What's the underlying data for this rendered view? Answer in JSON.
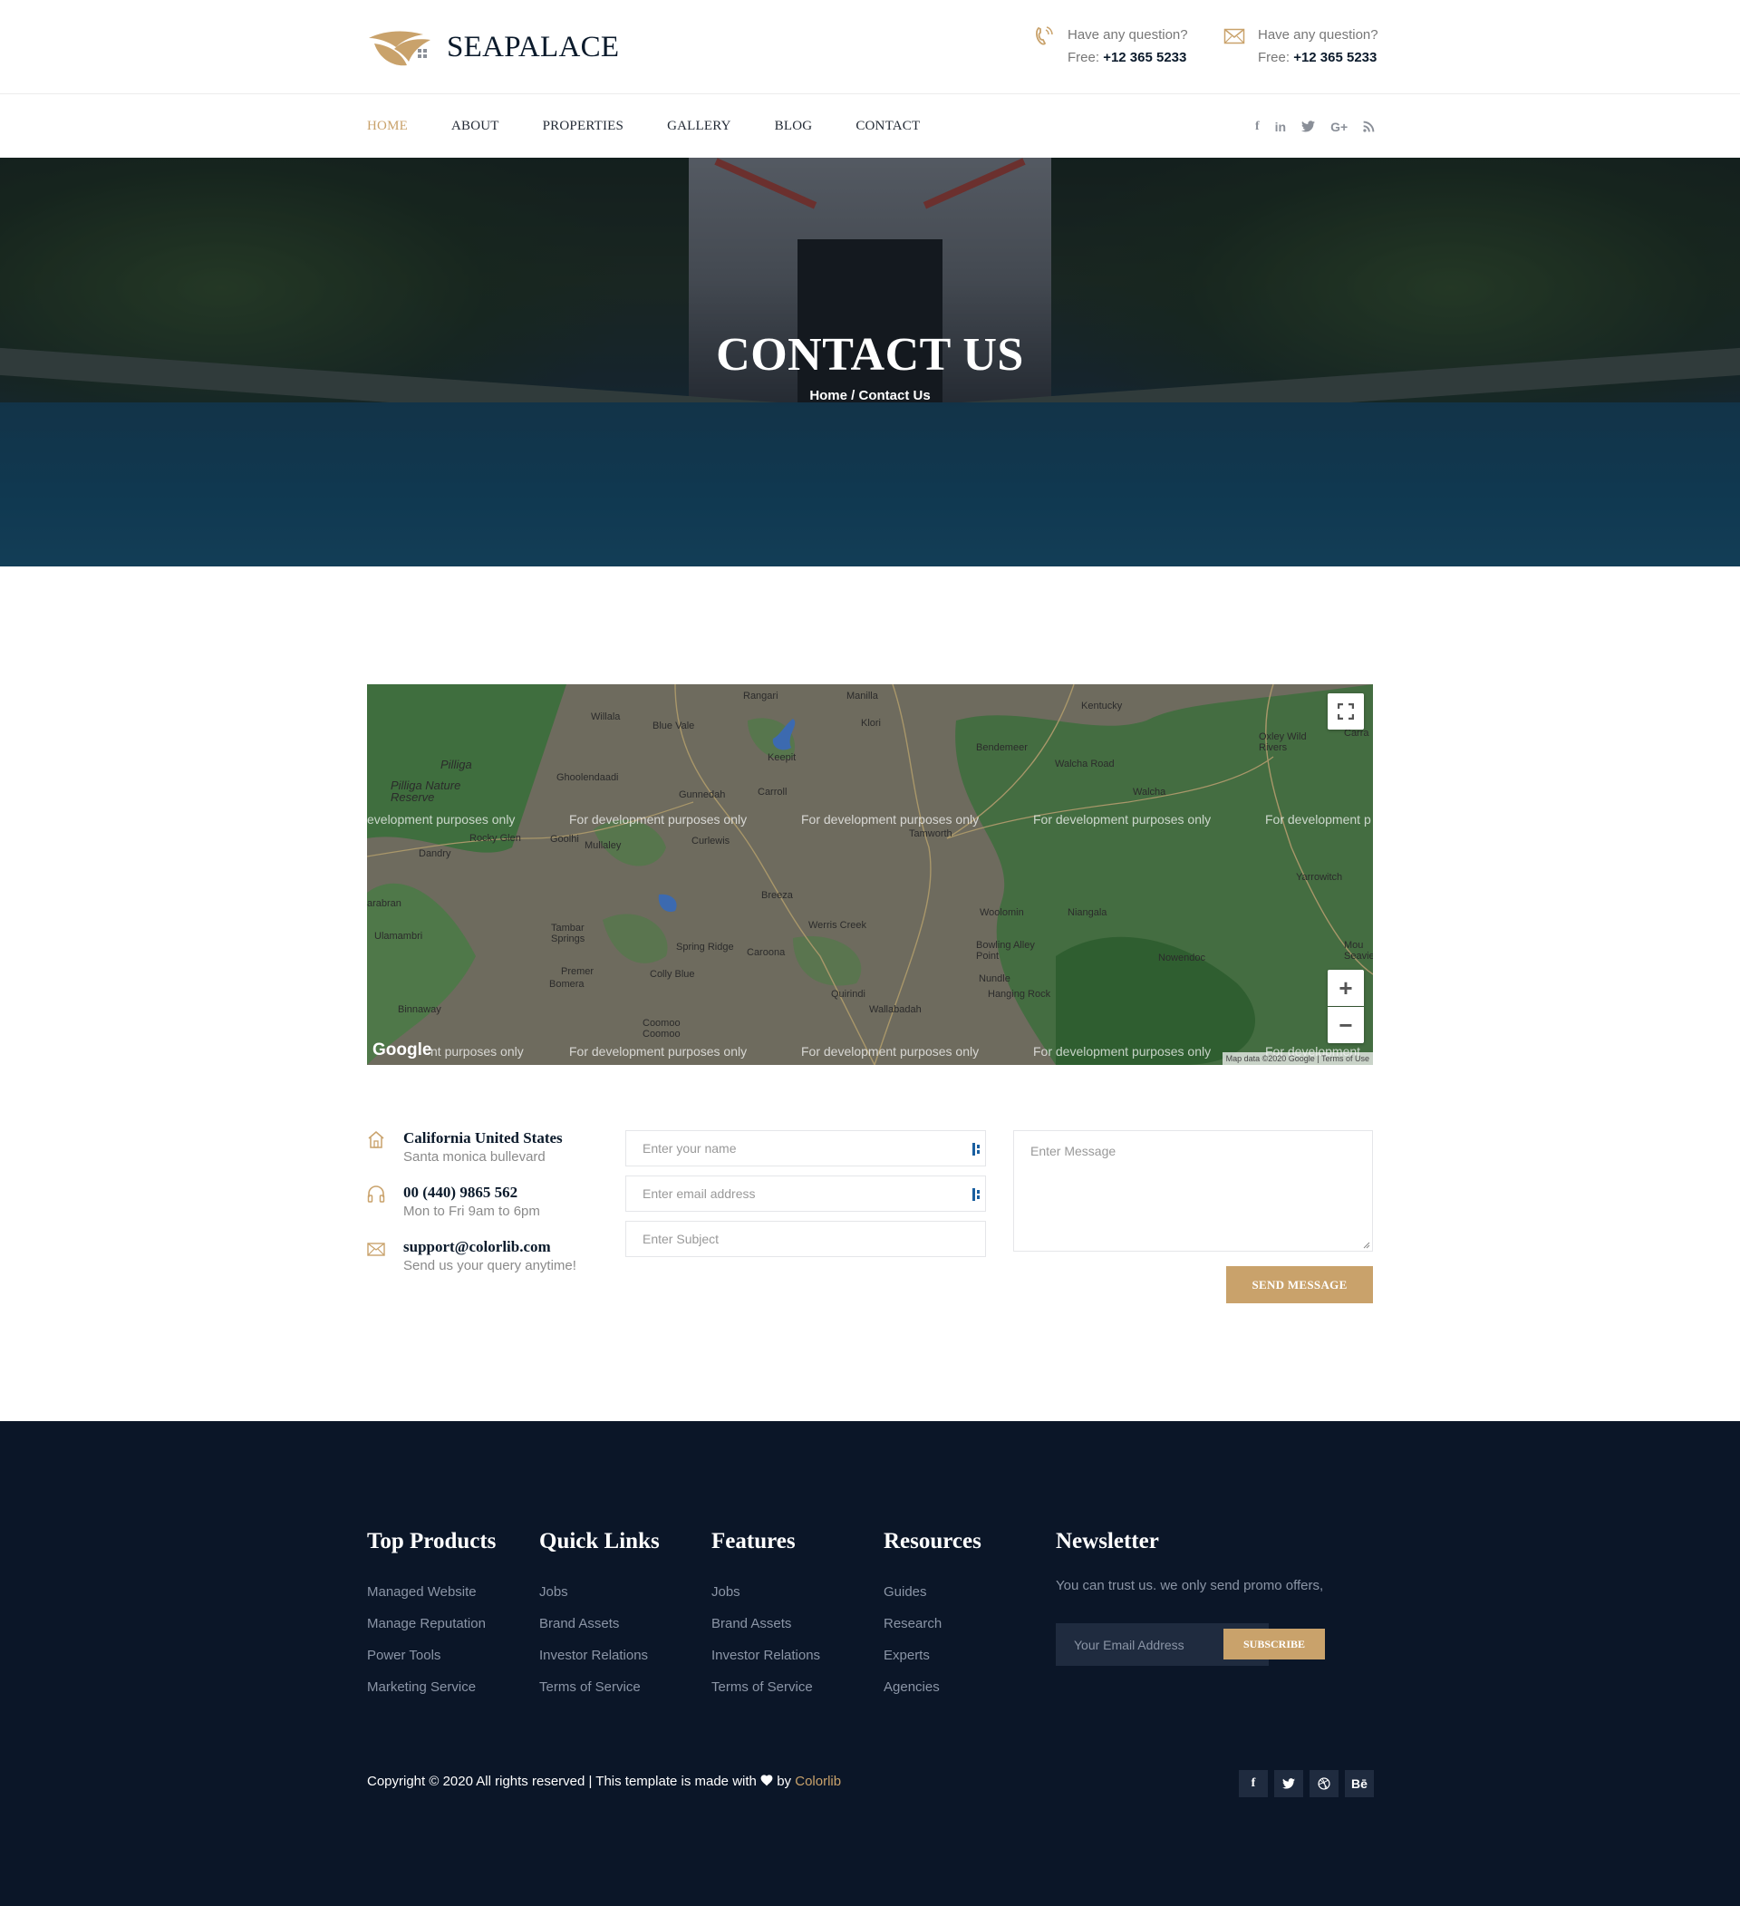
{
  "brand": {
    "name": "SEAPALACE"
  },
  "header": {
    "contacts": [
      {
        "icon": "phone-icon",
        "question": "Have any question?",
        "free_label": "Free:",
        "number": "+12 365 5233"
      },
      {
        "icon": "envelope-icon",
        "question": "Have any question?",
        "free_label": "Free:",
        "number": "+12 365 5233"
      }
    ]
  },
  "nav": {
    "items": [
      "HOME",
      "ABOUT",
      "PROPERTIES",
      "GALLERY",
      "BLOG",
      "CONTACT"
    ],
    "active": "HOME",
    "social": [
      "f",
      "in",
      "twitter-icon",
      "G+",
      "rss-icon"
    ]
  },
  "hero": {
    "title": "CONTACT US",
    "breadcrumb": "Home / Contact Us"
  },
  "map": {
    "watermark": "For development purposes only",
    "watermark_partial_left": "evelopment purposes only",
    "watermark_partial_right": "For development p",
    "watermark_bottom_left": "nt purposes only",
    "watermark_bottom_right": "For development",
    "places": [
      "Willala",
      "Blue Vale",
      "Rangari",
      "Manilla",
      "Kentucky",
      "Oxley Wild Rivers",
      "Pilliga",
      "Pilliga Nature Reserve",
      "Ghoolendaadi",
      "Keepit",
      "Klori",
      "Bendemeer",
      "Walcha Road",
      "Walcha",
      "Gunnedah",
      "Carroll",
      "Tamworth",
      "Rocky Glen",
      "Goolhi",
      "Mullaley",
      "Curlewis",
      "Dandry",
      "Yarrowitch",
      "arabran",
      "Breeza",
      "Woolomin",
      "Niangala",
      "Ulamambri",
      "Tambar Springs",
      "Werris Creek",
      "Spring Ridge",
      "Caroona",
      "Bowling Alley Point",
      "Nowendoc",
      "Premer",
      "Bomera",
      "Colly Blue",
      "Nundle",
      "Quirindi",
      "Hanging Rock",
      "Wallabadah",
      "Binnaway",
      "Coomoo Coomoo",
      "Mou Seavie",
      "Carra"
    ],
    "logo": "Google",
    "attribution": "Map data ©2020 Google | Terms of Use",
    "zoom_in": "+",
    "zoom_out": "−"
  },
  "contact_info": [
    {
      "icon": "home-icon",
      "title": "California United States",
      "sub": "Santa monica bullevard"
    },
    {
      "icon": "headphones-icon",
      "title": "00 (440) 9865 562",
      "sub": "Mon to Fri 9am to 6pm"
    },
    {
      "icon": "envelope-icon",
      "title": "support@colorlib.com",
      "sub": "Send us your query anytime!"
    }
  ],
  "form": {
    "name_placeholder": "Enter your name",
    "email_placeholder": "Enter email address",
    "subject_placeholder": "Enter Subject",
    "message_placeholder": "Enter Message",
    "submit_label": "SEND MESSAGE"
  },
  "footer": {
    "columns": [
      {
        "title": "Top Products",
        "links": [
          "Managed Website",
          "Manage Reputation",
          "Power Tools",
          "Marketing Service"
        ]
      },
      {
        "title": "Quick Links",
        "links": [
          "Jobs",
          "Brand Assets",
          "Investor Relations",
          "Terms of Service"
        ]
      },
      {
        "title": "Features",
        "links": [
          "Jobs",
          "Brand Assets",
          "Investor Relations",
          "Terms of Service"
        ]
      },
      {
        "title": "Resources",
        "links": [
          "Guides",
          "Research",
          "Experts",
          "Agencies"
        ]
      }
    ],
    "newsletter": {
      "title": "Newsletter",
      "text": "You can trust us. we only send promo offers,",
      "placeholder": "Your Email Address",
      "button": "SUBSCRIBE"
    },
    "copyright_pre": "Copyright © 2020 All rights reserved | This template is made with",
    "copyright_by": "by",
    "copyright_brand": "Colorlib",
    "social": [
      "f",
      "twitter-icon",
      "dribbble-icon",
      "Bē"
    ]
  },
  "colors": {
    "accent": "#c9a26b",
    "navy": "#0b1628",
    "text_dark": "#0b1a2b"
  }
}
